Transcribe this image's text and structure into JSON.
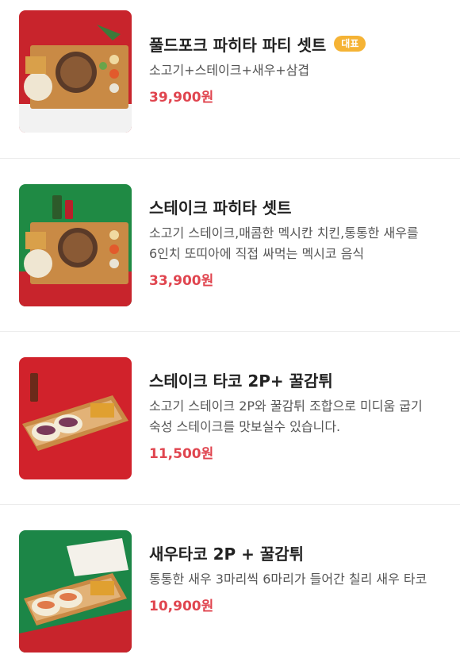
{
  "menu_items": [
    {
      "title": "풀드포크 파히타 파티 셋트",
      "badge": "대표",
      "description": "소고기+스테이크+새우+삼겹",
      "price": "39,900원",
      "image_bg": "#c8242c"
    },
    {
      "title": "스테이크 파히타 셋트",
      "badge": "",
      "description": "소고기 스테이크,매콤한 멕시칸 치킨,통통한 새우를 6인치 또띠아에 직접 싸먹는 멕시코 음식",
      "price": "33,900원",
      "image_bg": "#1f8a44"
    },
    {
      "title": "스테이크 타코 2P+ 꿀감튀",
      "badge": "",
      "description": "소고기 스테이크 2P와 꿀감튀 조합으로 미디움 굽기 숙성 스테이크를 맛보실수 있습니다.",
      "price": "11,500원",
      "image_bg": "#d1222b"
    },
    {
      "title": "새우타코 2P + 꿀감튀",
      "badge": "",
      "description": "통통한 새우 3마리씩 6마리가 들어간 칠리 새우 타코",
      "price": "10,900원",
      "image_bg": "#1c8647"
    }
  ],
  "colors": {
    "price": "#e0454f",
    "badge": "#f5b335",
    "title": "#222222",
    "description": "#555555"
  }
}
